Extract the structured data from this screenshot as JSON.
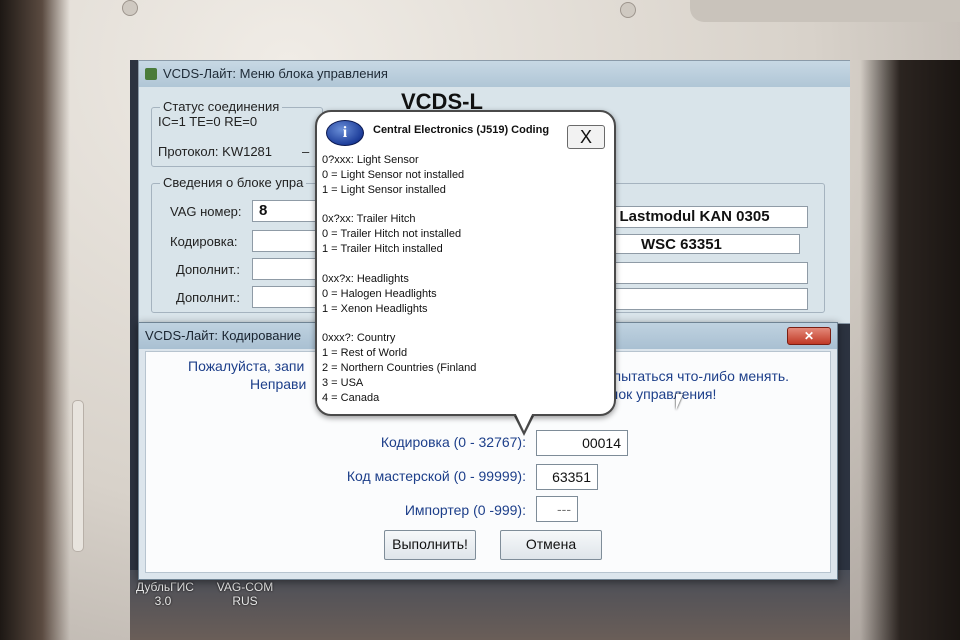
{
  "main_window": {
    "title": "VCDS-Лайт: Меню блока управления",
    "big_title": "VCDS-L",
    "connection": {
      "group_label": "Статус соединения",
      "status": "IC=1  TE=0  RE=0",
      "protocol": "Протокол: KW1281",
      "dash": "–"
    },
    "unit_info": {
      "group_label": "Сведения о блоке упра",
      "vag_label": "VAG номер:",
      "vag_value": "8",
      "coding_label": "Кодировка:",
      "extra1_label": "Дополнит.:",
      "extra2_label": "Дополнит.:",
      "component_value": "l. Lastmodul  KAN 0305",
      "wsc_value": "WSC 63351"
    }
  },
  "coding_dialog": {
    "title": "VCDS-Лайт: Кодирование",
    "close_label": "✕",
    "warning_line1_left": "Пожалуйста, запи",
    "warning_line1_right": "м пытаться что-либо менять.",
    "warning_line2_left": "Неправи",
    "warning_line2_right": "лок управления!",
    "coding_label": "Кодировка (0 - 32767):",
    "coding_value": "00014",
    "workshop_label": "Код мастерской (0 - 99999):",
    "workshop_value": "63351",
    "importer_label": "Импортер (0 -999):",
    "importer_value": "---",
    "execute_label": "Выполнить!",
    "cancel_label": "Отмена"
  },
  "info_balloon": {
    "title": "Central Electronics (J519) Coding",
    "icon_char": "i",
    "close_char": "X",
    "lines": [
      "0?xxx: Light Sensor",
      "0 = Light Sensor not installed",
      "1 = Light Sensor installed",
      "0x?xx: Trailer Hitch",
      "0 = Trailer Hitch not installed",
      "1 = Trailer Hitch installed",
      "0xx?x: Headlights",
      "0 = Halogen Headlights",
      "1 = Xenon Headlights",
      "0xxx?: Country",
      "1 = Rest of World",
      "2 = Northern Countries (Finland",
      "3 = USA",
      "4 = Canada"
    ]
  },
  "desktop": {
    "icon1": "ДубльГИС\n3.0",
    "icon2": "VAG-COM\nRUS"
  }
}
